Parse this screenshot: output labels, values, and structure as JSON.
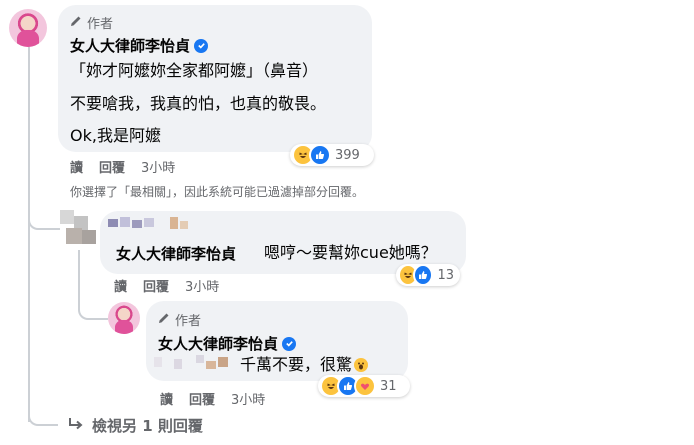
{
  "comment1": {
    "author_tag": "作者",
    "name": "女人大律師李怡貞",
    "lines": [
      "「妳才阿嬤妳全家都阿嬤」（鼻音）",
      "不要嗆我，我真的怕，也真的敬畏。",
      "Ok,我是阿嬤"
    ],
    "actions": {
      "read": "讀",
      "reply": "回覆",
      "time": "3小時"
    },
    "reaction_count": "399"
  },
  "notice": "你選擇了「最相關」，因此系統可能已過濾掉部分回覆。",
  "reply1": {
    "name": "女人大律師李怡貞",
    "text": "嗯哼～要幫妳cue她嗎？",
    "actions": {
      "read": "讀",
      "reply": "回覆",
      "time": "3小時"
    },
    "reaction_count": "13"
  },
  "reply2": {
    "author_tag": "作者",
    "name": "女人大律師李怡貞",
    "text": "千萬不要，很驚",
    "actions": {
      "read": "讀",
      "reply": "回覆",
      "time": "3小時"
    },
    "reaction_count": "31"
  },
  "view_more": "檢視另 1 則回覆",
  "colors": {
    "accent": "#1877f2",
    "bubble": "#f0f2f5",
    "muted": "#65676b"
  },
  "icons": [
    "pencil-icon",
    "verified-badge-icon",
    "haha-reaction-icon",
    "like-reaction-icon",
    "care-reaction-icon",
    "wow-emoji-icon",
    "reply-arrow-icon"
  ]
}
